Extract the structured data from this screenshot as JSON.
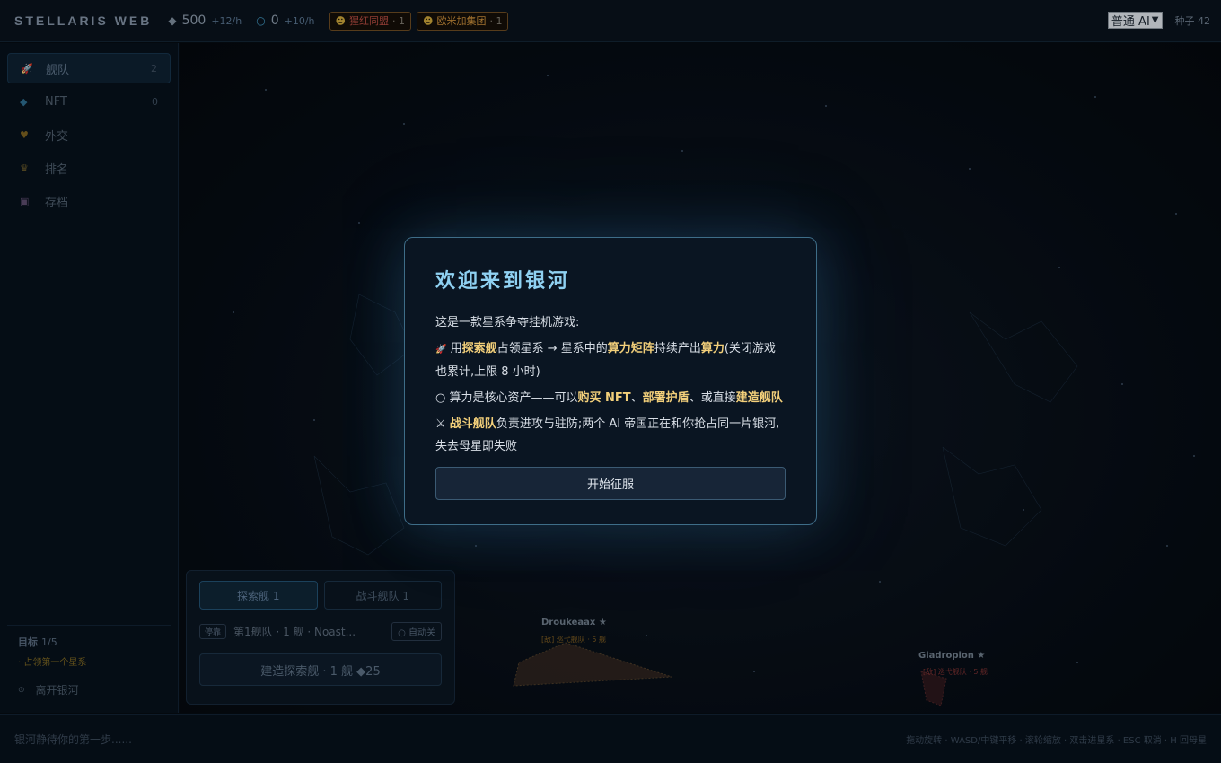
{
  "topbar": {
    "brand": "STELLARIS WEB",
    "compute": {
      "value": "500",
      "rate": "+12/h"
    },
    "other": {
      "value": "0",
      "rate": "+10/h"
    },
    "factions": [
      {
        "name": "猩红同盟",
        "count": "· 1"
      },
      {
        "name": "欧米加集团",
        "count": "· 1"
      }
    ],
    "ai_level": "普通 AI",
    "seed": "种子 42"
  },
  "sidebar": {
    "items": [
      {
        "label": "舰队",
        "count": "2"
      },
      {
        "label": "NFT",
        "count": "0"
      },
      {
        "label": "外交",
        "count": ""
      },
      {
        "label": "排名",
        "count": ""
      },
      {
        "label": "存档",
        "count": ""
      }
    ],
    "goal": {
      "title": "目标",
      "progress": "1/5",
      "item": "· 占领第一个星系"
    },
    "leave": "离开银河"
  },
  "map": {
    "systems": [
      {
        "name": "Droukeaax ★",
        "fleet": "[敌] 巡弋舰队 · 5 舰"
      },
      {
        "name": "Giadropion ★",
        "fleet": "[敌] 巡弋舰队 · 5 舰"
      }
    ]
  },
  "fleet_panel": {
    "tabs": [
      "探索舰 1",
      "战斗舰队 1"
    ],
    "row": {
      "tag": "停靠",
      "name": "第1舰队 · 1 舰 · Noast...",
      "auto": "自动关"
    },
    "build": "建造探索舰 · 1 舰 ◆25"
  },
  "bottombar": {
    "message": "银河静待你的第一步......",
    "hints": "拖动旋转 · WASD/中键平移 · 滚轮缩放 · 双击进星系 · ESC 取消 · H 回母星"
  },
  "modal": {
    "title": "欢迎来到银河",
    "intro": "这是一款星系争夺挂机游戏:",
    "p1": {
      "a": "用",
      "b": "探索舰",
      "c": "占领星系 → 星系中的",
      "d": "算力矩阵",
      "e": "持续产出",
      "f": "算力",
      "g": "(关闭游戏也累计,上限 8 小时)"
    },
    "p2": {
      "a": "算力是核心资产——可以",
      "b": "购买 NFT",
      "c": "、",
      "d": "部署护盾",
      "e": "、或直接",
      "f": "建造舰队"
    },
    "p3": {
      "b": "战斗舰队",
      "c": "负责进攻与驻防;两个 AI 帝国正在和你抢占同一片银河,失去母星即失败"
    },
    "start": "开始征服"
  }
}
